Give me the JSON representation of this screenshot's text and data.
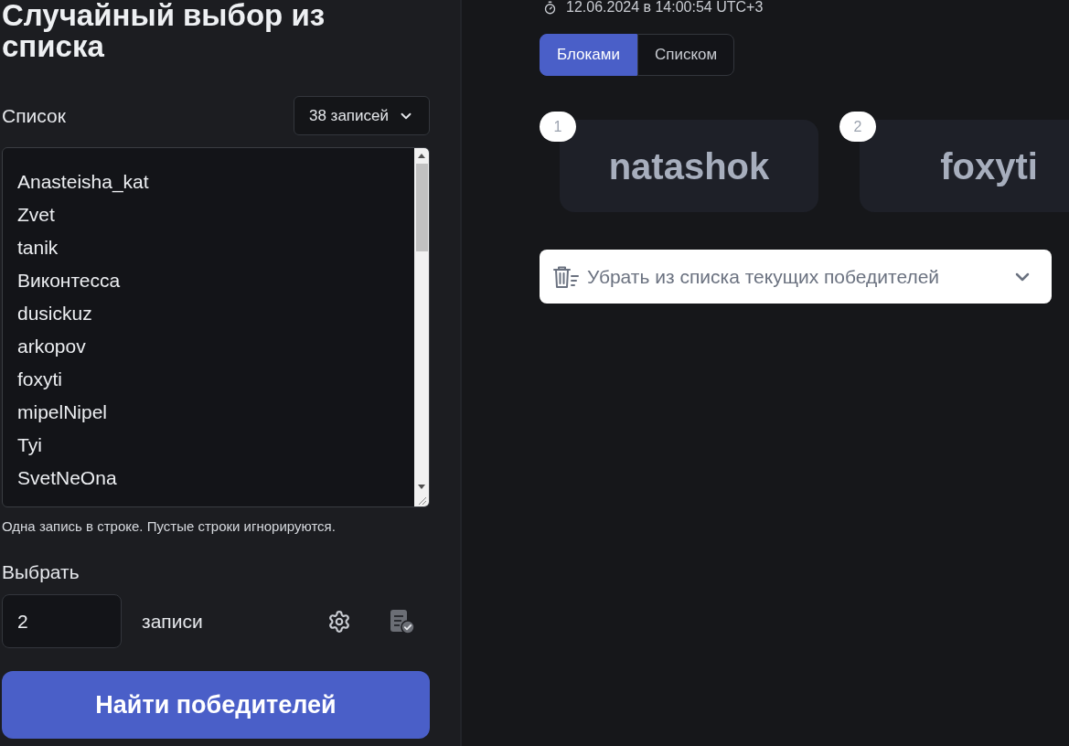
{
  "title": "Случайный выбор из списка",
  "list": {
    "label": "Список",
    "count_button": "38 записей",
    "entries": [
      "Anasteisha_kat",
      "Zvet",
      "tanik",
      "Виконтесса",
      "dusickuz",
      "arkopov",
      "foxyti",
      "mipelNipel",
      "Tyi",
      "SvetNeOna"
    ],
    "hint": "Одна запись в строке. Пустые строки игнорируются."
  },
  "pick": {
    "label": "Выбрать",
    "count_value": "2",
    "unit": "записи"
  },
  "submit_button": "Найти победителей",
  "result": {
    "timestamp": "12.06.2024 в 14:00:54 UTC+3",
    "view_tabs": [
      {
        "label": "Блоками",
        "selected": true
      },
      {
        "label": "Списком",
        "selected": false
      }
    ],
    "winners": [
      {
        "rank": "1",
        "name": "natashok"
      },
      {
        "rank": "2",
        "name": "foxyti"
      }
    ],
    "remove_dropdown": "Убрать из списка текущих победителей"
  }
}
